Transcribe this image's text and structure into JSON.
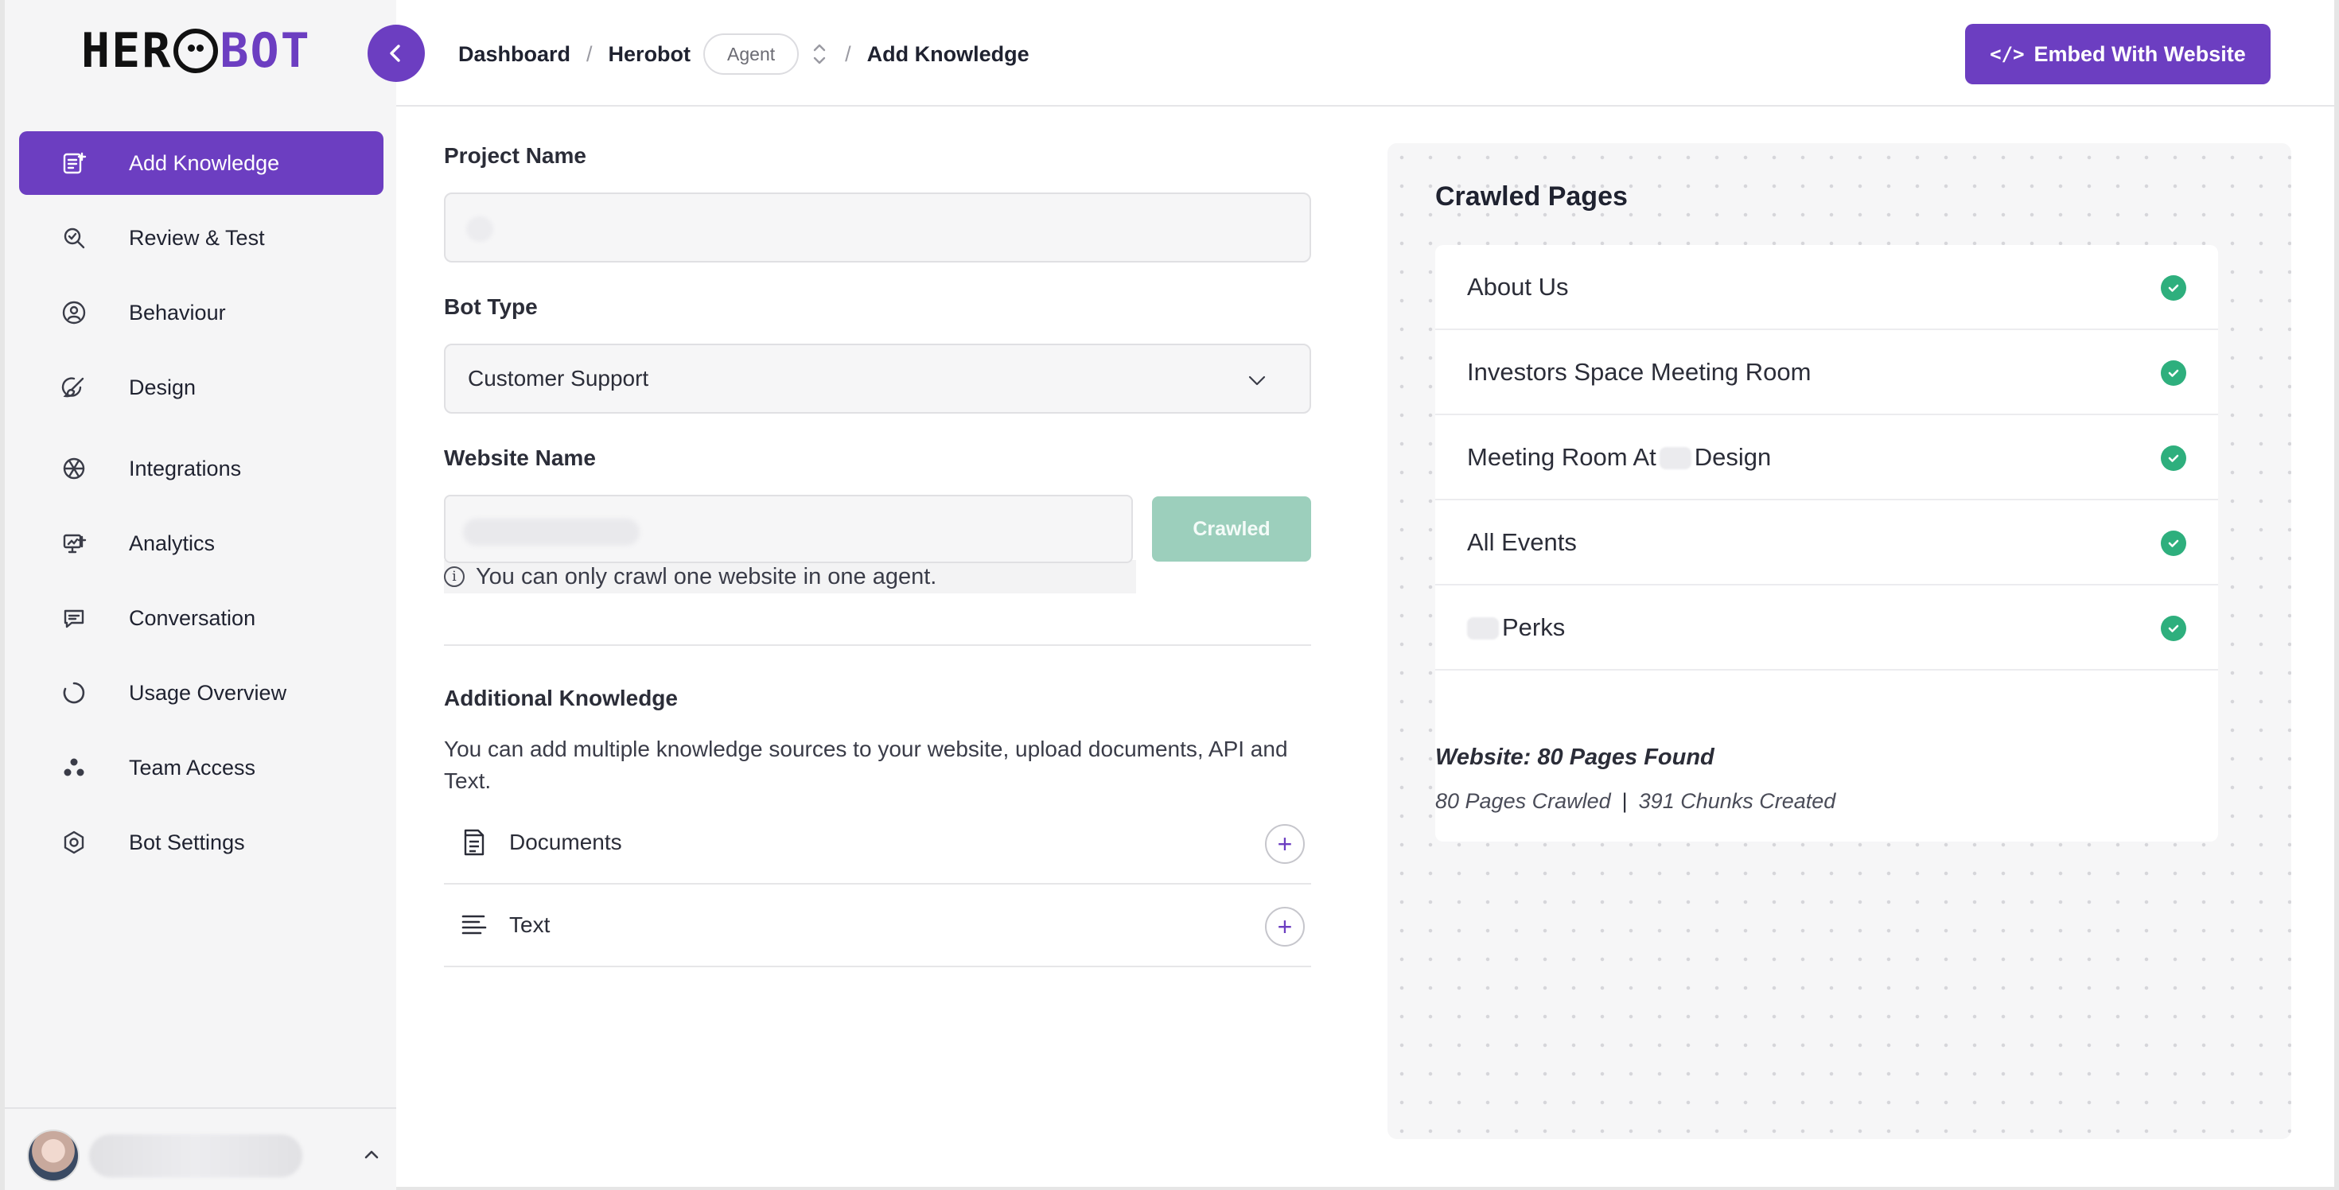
{
  "brand": {
    "logo_left": "HER",
    "logo_right": "BOT",
    "accent": "#6c3ec1"
  },
  "sidebar": {
    "items": [
      {
        "label": "Add Knowledge",
        "icon": "add-note-icon",
        "active": true
      },
      {
        "label": "Review & Test",
        "icon": "magnify-icon",
        "active": false
      },
      {
        "label": "Behaviour",
        "icon": "user-cog-icon",
        "active": false
      },
      {
        "label": "Design",
        "icon": "brush-icon",
        "active": false
      },
      {
        "label": "Integrations",
        "icon": "aperture-icon",
        "active": false
      },
      {
        "label": "Analytics",
        "icon": "monitor-chart-icon",
        "active": false
      },
      {
        "label": "Conversation",
        "icon": "chat-icon",
        "active": false
      },
      {
        "label": "Usage Overview",
        "icon": "circle-progress-icon",
        "active": false
      },
      {
        "label": "Team Access",
        "icon": "team-dots-icon",
        "active": false
      },
      {
        "label": "Bot Settings",
        "icon": "hex-gear-icon",
        "active": false
      }
    ]
  },
  "header": {
    "breadcrumb": [
      "Dashboard",
      "Herobot",
      "Add Knowledge"
    ],
    "agent_label": "Agent",
    "embed_label": "Embed With Website"
  },
  "form": {
    "project_name_label": "Project Name",
    "bot_type_label": "Bot Type",
    "bot_type_value": "Customer Support",
    "website_name_label": "Website Name",
    "crawled_label": "Crawled",
    "hint": "You can only crawl one website in one agent.",
    "additional_title": "Additional Knowledge",
    "additional_desc": "You can add multiple knowledge sources to your website, upload documents, API and Text.",
    "sources": [
      {
        "label": "Documents",
        "icon": "document-icon"
      },
      {
        "label": "Text",
        "icon": "text-lines-icon"
      }
    ]
  },
  "crawled": {
    "title": "Crawled Pages",
    "pages": [
      {
        "pre": "About Us",
        "post": ""
      },
      {
        "pre": "Investors Space Meeting Room",
        "post": ""
      },
      {
        "pre": "Meeting Room At",
        "post": "Design"
      },
      {
        "pre": "All Events",
        "post": ""
      },
      {
        "pre": "",
        "post": "Perks"
      }
    ],
    "website_summary": "Website: 80 Pages Found",
    "pages_crawled": "80 Pages Crawled",
    "chunks_created": "391 Chunks Created",
    "status_color": "#2eaf7d"
  }
}
